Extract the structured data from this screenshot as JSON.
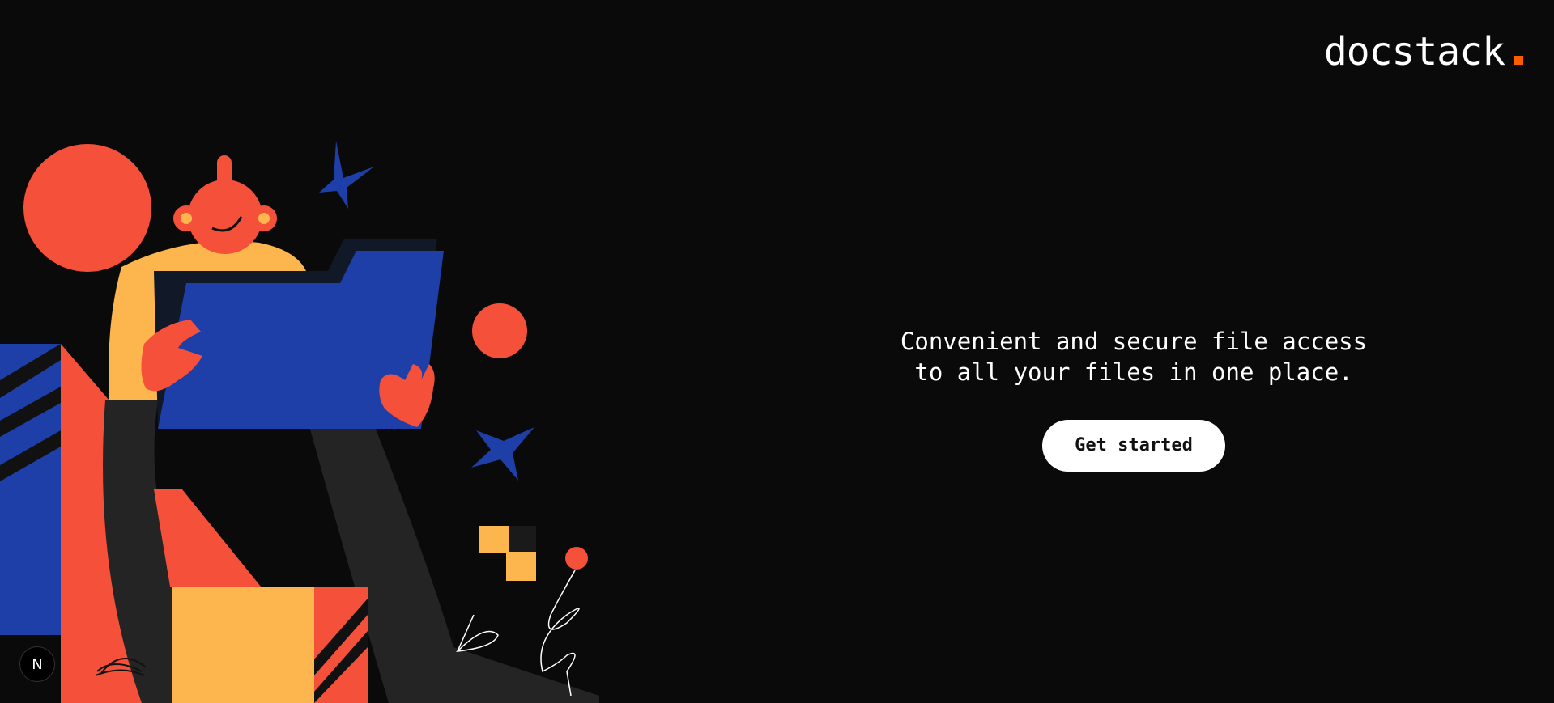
{
  "brand": {
    "name": "docstack",
    "accent_color": "#ff5c00"
  },
  "hero": {
    "tagline_line1": "Convenient and secure file access",
    "tagline_line2": "to all your files in one place.",
    "cta_label": "Get started"
  },
  "badge": {
    "label": "N",
    "icon": "nextjs-icon"
  },
  "illustration": {
    "icon": "person-holding-folder-illustration",
    "colors": {
      "red": "#f5503a",
      "blue": "#1f3fa8",
      "yellow": "#fdb54d",
      "dark": "#242424"
    }
  }
}
